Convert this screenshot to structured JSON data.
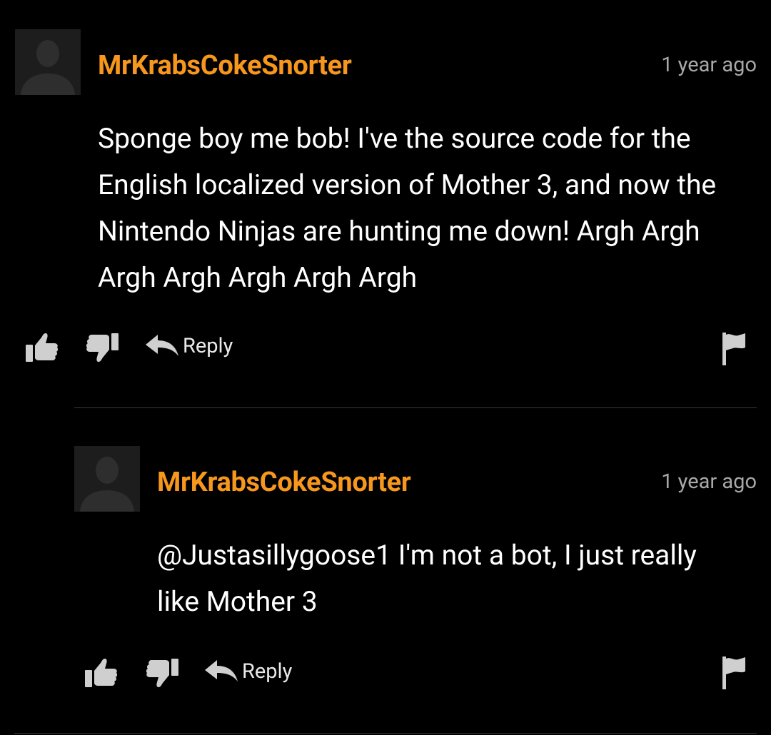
{
  "colors": {
    "background": "#000000",
    "username": "#f7971d",
    "timestamp": "#a8a8a8",
    "text": "#ffffff",
    "icon": "#cfcfcf",
    "divider": "#3a3a3a"
  },
  "comments": [
    {
      "username": "MrKrabsCokeSnorter",
      "timestamp": "1 year ago",
      "text": "Sponge boy me bob! I've the source code for the English localized version of Mother 3, and now the Nintendo Ninjas are hunting me down! Argh Argh Argh Argh Argh Argh Argh",
      "avatar_icon": "default-user-silhouette",
      "actions": {
        "like_icon": "thumbs-up-icon",
        "dislike_icon": "thumbs-down-icon",
        "reply_icon": "reply-arrow-icon",
        "reply_label": "Reply",
        "flag_icon": "flag-icon"
      }
    },
    {
      "username": "MrKrabsCokeSnorter",
      "timestamp": "1 year ago",
      "text": "@Justasillygoose1 I'm not a bot, I just really like Mother 3",
      "avatar_icon": "default-user-silhouette",
      "actions": {
        "like_icon": "thumbs-up-icon",
        "dislike_icon": "thumbs-down-icon",
        "reply_icon": "reply-arrow-icon",
        "reply_label": "Reply",
        "flag_icon": "flag-icon"
      }
    }
  ]
}
